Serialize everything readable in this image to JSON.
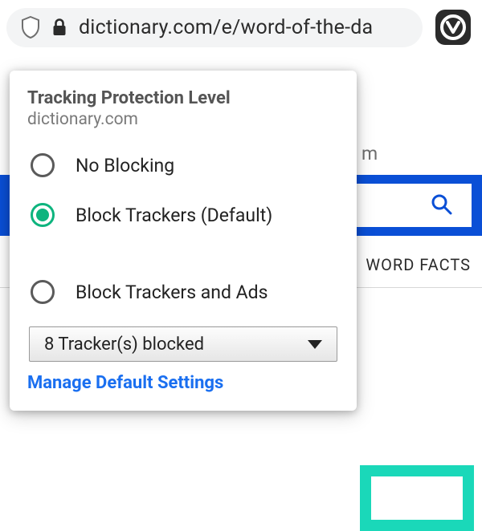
{
  "addressBar": {
    "url": "dictionary.com/e/word-of-the-da"
  },
  "pageBehind": {
    "partialText": "m",
    "navItem": "WORD FACTS"
  },
  "popup": {
    "title": "Tracking Protection Level",
    "site": "dictionary.com",
    "options": [
      {
        "label": "No Blocking",
        "selected": false
      },
      {
        "label": "Block Trackers (Default)",
        "selected": true
      },
      {
        "label": "Block Trackers and Ads",
        "selected": false
      }
    ],
    "dropdownText": "8 Tracker(s) blocked",
    "manageLink": "Manage Default Settings"
  }
}
